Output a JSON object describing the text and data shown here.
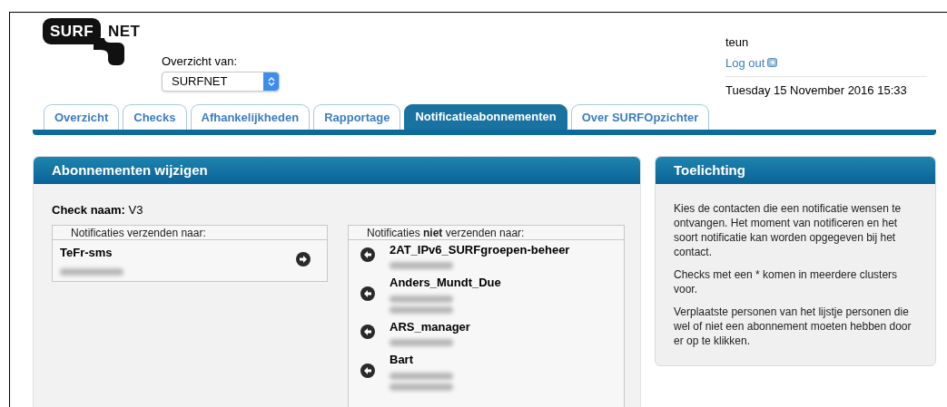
{
  "logo": {
    "dark": "SURF",
    "light": "NET"
  },
  "selector": {
    "label": "Overzicht van:",
    "value": "SURFNET"
  },
  "user": {
    "name": "teun",
    "logout": "Log out",
    "datetime": "Tuesday 15 November 2016 15:33"
  },
  "tabs": [
    {
      "label": "Overzicht",
      "selected": false
    },
    {
      "label": "Checks",
      "selected": false
    },
    {
      "label": "Afhankelijkheden",
      "selected": false
    },
    {
      "label": "Rapportage",
      "selected": false
    },
    {
      "label": "Notificatieabonnementen",
      "selected": true
    },
    {
      "label": "Over SURFOpzichter",
      "selected": false
    }
  ],
  "main_panel": {
    "title": "Abonnementen wijzigen",
    "check_label": "Check naam:",
    "check_value": "V3",
    "send_list": {
      "heading": "Notificaties verzenden naar:",
      "contacts": [
        {
          "name": "TeFr-sms",
          "details": [
            {
              "kind": "blurred"
            }
          ]
        }
      ]
    },
    "no_send_list": {
      "heading": "Notificaties **niet** verzenden naar:",
      "contacts": [
        {
          "name": "2AT_IPv6_SURFgroepen-beheer",
          "details": [
            {
              "kind": "blurred"
            }
          ]
        },
        {
          "name": "Anders_Mundt_Due",
          "details": [
            {
              "kind": "blurred"
            },
            {
              "kind": "blurred"
            }
          ]
        },
        {
          "name": "ARS_manager",
          "details": [
            {
              "kind": "blurred"
            }
          ]
        },
        {
          "name": "Bart",
          "details": [
            {
              "kind": "blurred"
            },
            {
              "kind": "blurred"
            }
          ]
        }
      ]
    }
  },
  "help_panel": {
    "title": "Toelichting",
    "paragraphs": [
      "Kies de contacten die een notificatie wensen te ontvangen. Het moment van notificeren en het soort notificatie kan worden opgegeven bij het contact.",
      "Checks met een * komen in meerdere clusters voor.",
      "Verplaatste personen van het lijstje personen die wel of niet een abonnement moeten hebben door er op te klikken."
    ]
  }
}
